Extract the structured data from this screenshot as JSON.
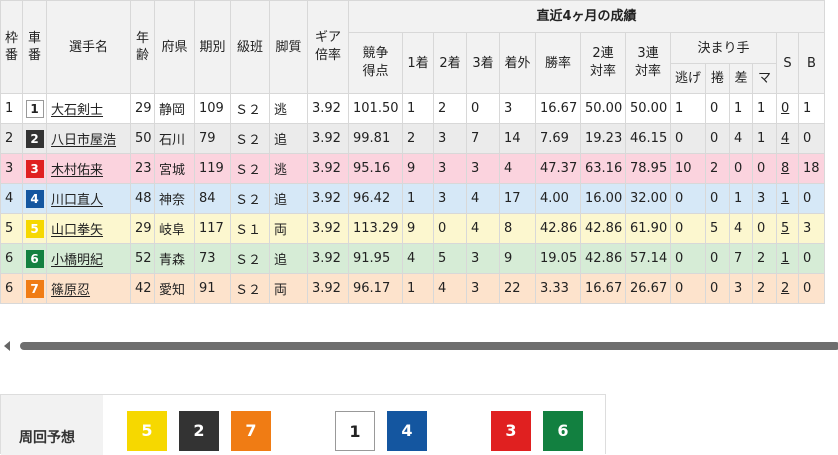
{
  "header": {
    "waku": "枠番",
    "sha": "車番",
    "name": "選手名",
    "age": "年齢",
    "pref": "府県",
    "term": "期別",
    "class": "級班",
    "leg": "脚質",
    "gear": "ギア倍率",
    "recent": "直近4ヶ月の成績",
    "score": "競争得点",
    "first": "1着",
    "second": "2着",
    "third": "3着",
    "out": "着外",
    "win": "勝率",
    "ren2": "2連対率",
    "ren3": "3連対率",
    "kimarite": "決まり手",
    "nige": "逃げ",
    "makuri": "捲",
    "sashi": "差",
    "mark": "マ",
    "s": "S",
    "b": "B"
  },
  "colors": {
    "1": {
      "bg": "#ffffff",
      "fg": "#222222",
      "border": "#999999"
    },
    "2": {
      "bg": "#333333",
      "fg": "#ffffff"
    },
    "3": {
      "bg": "#e02020",
      "fg": "#ffffff"
    },
    "4": {
      "bg": "#1456a0",
      "fg": "#ffffff"
    },
    "5": {
      "bg": "#f6d800",
      "fg": "#ffffff"
    },
    "6": {
      "bg": "#128040",
      "fg": "#ffffff"
    },
    "7": {
      "bg": "#f07c14",
      "fg": "#ffffff"
    }
  },
  "rows": [
    {
      "waku": "1",
      "sha": "1",
      "name": "大石剣士",
      "age": "29",
      "pref": "静岡",
      "term": "109",
      "cls": "Ｓ２",
      "leg": "逃",
      "gear": "3.92",
      "score": "101.50",
      "f1": "1",
      "f2": "2",
      "f3": "0",
      "out": "3",
      "win": "16.67",
      "r2": "50.00",
      "r3": "50.00",
      "nige": "1",
      "makuri": "0",
      "sashi": "1",
      "mark": "1",
      "s": "0",
      "b": "1",
      "rowbg": "#ffffff"
    },
    {
      "waku": "2",
      "sha": "2",
      "name": "八日市屋浩",
      "age": "50",
      "pref": "石川",
      "term": "79",
      "cls": "Ｓ２",
      "leg": "追",
      "gear": "3.92",
      "score": "99.81",
      "f1": "2",
      "f2": "3",
      "f3": "7",
      "out": "14",
      "win": "7.69",
      "r2": "19.23",
      "r3": "46.15",
      "nige": "0",
      "makuri": "0",
      "sashi": "4",
      "mark": "1",
      "s": "4",
      "b": "0",
      "rowbg": "#ebebeb"
    },
    {
      "waku": "3",
      "sha": "3",
      "name": "木村佑来",
      "age": "23",
      "pref": "宮城",
      "term": "119",
      "cls": "Ｓ２",
      "leg": "逃",
      "gear": "3.92",
      "score": "95.16",
      "f1": "9",
      "f2": "3",
      "f3": "3",
      "out": "4",
      "win": "47.37",
      "r2": "63.16",
      "r3": "78.95",
      "nige": "10",
      "makuri": "2",
      "sashi": "0",
      "mark": "0",
      "s": "8",
      "b": "18",
      "rowbg": "#fbd3de"
    },
    {
      "waku": "4",
      "sha": "4",
      "name": "川口直人",
      "age": "48",
      "pref": "神奈",
      "term": "84",
      "cls": "Ｓ２",
      "leg": "追",
      "gear": "3.92",
      "score": "96.42",
      "f1": "1",
      "f2": "3",
      "f3": "4",
      "out": "17",
      "win": "4.00",
      "r2": "16.00",
      "r3": "32.00",
      "nige": "0",
      "makuri": "0",
      "sashi": "1",
      "mark": "3",
      "s": "1",
      "b": "0",
      "rowbg": "#d6e8f7"
    },
    {
      "waku": "5",
      "sha": "5",
      "name": "山口拳矢",
      "age": "29",
      "pref": "岐阜",
      "term": "117",
      "cls": "Ｓ１",
      "leg": "両",
      "gear": "3.92",
      "score": "113.29",
      "f1": "9",
      "f2": "0",
      "f3": "4",
      "out": "8",
      "win": "42.86",
      "r2": "42.86",
      "r3": "61.90",
      "nige": "0",
      "makuri": "5",
      "sashi": "4",
      "mark": "0",
      "s": "5",
      "b": "3",
      "rowbg": "#fcf7cf"
    },
    {
      "waku": "6",
      "sha": "6",
      "name": "小橋明紀",
      "age": "52",
      "pref": "青森",
      "term": "73",
      "cls": "Ｓ２",
      "leg": "追",
      "gear": "3.92",
      "score": "91.95",
      "f1": "4",
      "f2": "5",
      "f3": "3",
      "out": "9",
      "win": "19.05",
      "r2": "42.86",
      "r3": "57.14",
      "nige": "0",
      "makuri": "0",
      "sashi": "7",
      "mark": "2",
      "s": "1",
      "b": "0",
      "rowbg": "#d6ecd6"
    },
    {
      "waku": "6",
      "sha": "7",
      "name": "篠原忍",
      "age": "42",
      "pref": "愛知",
      "term": "91",
      "cls": "Ｓ２",
      "leg": "両",
      "gear": "3.92",
      "score": "96.17",
      "f1": "1",
      "f2": "4",
      "f3": "3",
      "out": "22",
      "win": "3.33",
      "r2": "16.67",
      "r3": "26.67",
      "nige": "0",
      "makuri": "0",
      "sashi": "3",
      "mark": "2",
      "s": "2",
      "b": "0",
      "rowbg": "#fde3cc"
    }
  ],
  "prediction": {
    "label": "周回予想",
    "items": [
      "5",
      "2",
      "7",
      "1",
      "4",
      "3",
      "6"
    ]
  }
}
